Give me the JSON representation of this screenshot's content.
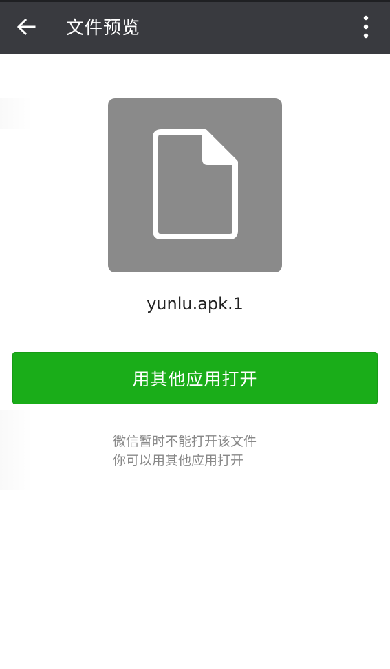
{
  "header": {
    "title": "文件预览",
    "back_icon": "arrow-left-icon",
    "more_icon": "more-vertical-icon"
  },
  "file": {
    "icon": "document-icon",
    "name": "yunlu.apk.1"
  },
  "actions": {
    "open_label": "用其他应用打开"
  },
  "hint": {
    "line1": "微信暂时不能打开该文件",
    "line2": "你可以用其他应用打开"
  },
  "colors": {
    "topbar_bg": "#393a3f",
    "primary_green": "#1aad19",
    "thumb_bg": "#8a8a8a",
    "hint_text": "#888888"
  }
}
